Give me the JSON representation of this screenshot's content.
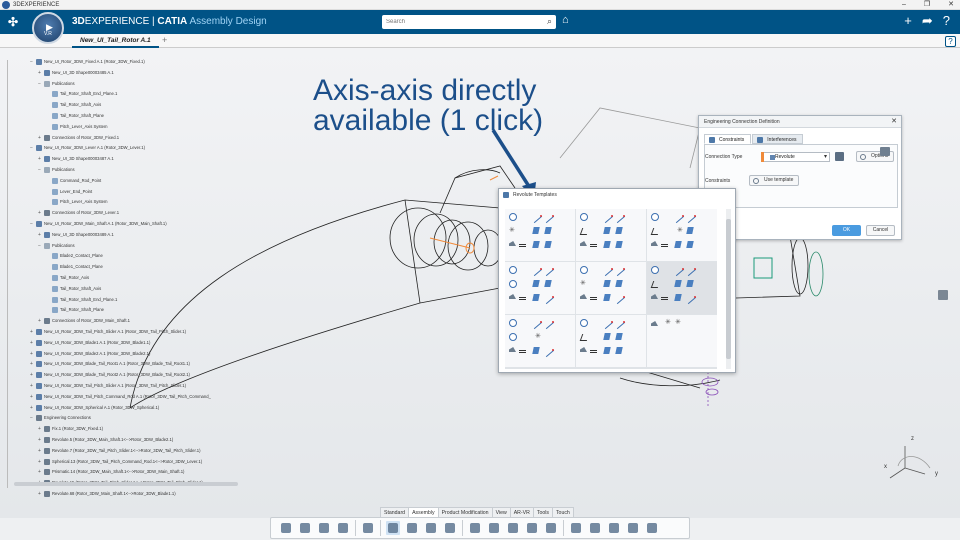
{
  "window": {
    "title": "3DEXPERIENCE",
    "controls": [
      "–",
      "❐",
      "✕"
    ]
  },
  "header": {
    "brand_bold": "3D",
    "brand_rest": "EXPERIENCE",
    "separator": " | ",
    "app_name": "CATIA",
    "app_sub": " Assembly Design",
    "compass_version": "V.R",
    "search_placeholder": "Search"
  },
  "tabs": {
    "active": "New_UI_Tail_Rotor A.1",
    "add": "+"
  },
  "tree": {
    "nodes": [
      {
        "label": "New_UI_Rotor_3DW_Fixed A.1 (Rotor_3DW_Fixed.1)",
        "level": 0,
        "icon": "product-icon",
        "toggle": "−"
      },
      {
        "label": "New_UI_3D Shape00003485 A.1",
        "level": 1,
        "icon": "shape-icon",
        "toggle": "+"
      },
      {
        "label": "Publications",
        "level": 1,
        "icon": "publications-icon",
        "toggle": "−"
      },
      {
        "label": "Tail_Rotor_Shaft_End_Plane.1",
        "level": 2,
        "icon": "plane-icon",
        "toggle": ""
      },
      {
        "label": "Tail_Rotor_Shaft_Axis",
        "level": 2,
        "icon": "plane-icon",
        "toggle": ""
      },
      {
        "label": "Tail_Rotor_Shaft_Plane",
        "level": 2,
        "icon": "plane-icon",
        "toggle": ""
      },
      {
        "label": "Pitch_Lever_Axis System",
        "level": 2,
        "icon": "plane-icon",
        "toggle": ""
      },
      {
        "label": "Connections of Rotor_3DW_Fixed.1",
        "level": 1,
        "icon": "connections-icon",
        "toggle": "+"
      },
      {
        "label": "New_UI_Rotor_3DW_Lever A.1 (Rotor_3DW_Lever.1)",
        "level": 0,
        "icon": "product-icon",
        "toggle": "−"
      },
      {
        "label": "New_UI_3D Shape00003487 A.1",
        "level": 1,
        "icon": "shape-icon",
        "toggle": "+"
      },
      {
        "label": "Publications",
        "level": 1,
        "icon": "publications-icon",
        "toggle": "−"
      },
      {
        "label": "Command_Rod_Point",
        "level": 2,
        "icon": "plane-icon",
        "toggle": ""
      },
      {
        "label": "Lever_End_Point",
        "level": 2,
        "icon": "plane-icon",
        "toggle": ""
      },
      {
        "label": "Pitch_Lever_Axis System",
        "level": 2,
        "icon": "plane-icon",
        "toggle": ""
      },
      {
        "label": "Connections of Rotor_3DW_Lever.1",
        "level": 1,
        "icon": "connections-icon",
        "toggle": "+"
      },
      {
        "label": "New_UI_Rotor_3DW_Main_Shaft A.1 (Rotor_3DW_Main_Shaft.1)",
        "level": 0,
        "icon": "product-icon",
        "toggle": "−"
      },
      {
        "label": "New_UI_3D Shape00003489 A.1",
        "level": 1,
        "icon": "shape-icon",
        "toggle": "+"
      },
      {
        "label": "Publications",
        "level": 1,
        "icon": "publications-icon",
        "toggle": "−"
      },
      {
        "label": "Blade2_Contact_Plane",
        "level": 2,
        "icon": "plane-icon",
        "toggle": ""
      },
      {
        "label": "Blade1_Contact_Plane",
        "level": 2,
        "icon": "plane-icon",
        "toggle": ""
      },
      {
        "label": "Tail_Rotor_Axis",
        "level": 2,
        "icon": "plane-icon",
        "toggle": ""
      },
      {
        "label": "Tail_Rotor_Shaft_Axis",
        "level": 2,
        "icon": "plane-icon",
        "toggle": ""
      },
      {
        "label": "Tail_Rotor_Shaft_End_Plane.1",
        "level": 2,
        "icon": "plane-icon",
        "toggle": ""
      },
      {
        "label": "Tail_Rotor_Shaft_Plane",
        "level": 2,
        "icon": "plane-icon",
        "toggle": ""
      },
      {
        "label": "Connections of Rotor_3DW_Main_Shaft.1",
        "level": 1,
        "icon": "connections-icon",
        "toggle": "+"
      },
      {
        "label": "New_UI_Rotor_3DW_Tail_Pitch_Slider A.1 (Rotor_3DW_Tail_Pitch_Slider.1)",
        "level": 0,
        "icon": "product-icon",
        "toggle": "+"
      },
      {
        "label": "New_UI_Rotor_3DW_Blade1 A.1 (Rotor_3DW_Blade1.1)",
        "level": 0,
        "icon": "product-icon",
        "toggle": "+"
      },
      {
        "label": "New_UI_Rotor_3DW_Blade2 A.1 (Rotor_3DW_Blade2.1)",
        "level": 0,
        "icon": "product-icon",
        "toggle": "+"
      },
      {
        "label": "New_UI_Rotor_3DW_Blade_Tail_Root1 A.1 (Rotor_3DW_Blade_Tail_Root1.1)",
        "level": 0,
        "icon": "product-icon",
        "toggle": "+"
      },
      {
        "label": "New_UI_Rotor_3DW_Blade_Tail_Root2 A.1 (Rotor_3DW_Blade_Tail_Root2.1)",
        "level": 0,
        "icon": "product-icon",
        "toggle": "+"
      },
      {
        "label": "New_UI_Rotor_3DW_Tail_Pitch_Slider A.1 (Rotor_3DW_Tail_Pitch_Slider.1)",
        "level": 0,
        "icon": "product-icon",
        "toggle": "+"
      },
      {
        "label": "New_UI_Rotor_3DW_Tail_Pitch_Command_Rod A.1 (Rotor_3DW_Tail_Pitch_Command_",
        "level": 0,
        "icon": "product-icon",
        "toggle": "+"
      },
      {
        "label": "New_UI_Rotor_3DW_Spherical A.1 (Rotor_3DW_Spherical.1)",
        "level": 0,
        "icon": "product-icon",
        "toggle": "+"
      },
      {
        "label": "Engineering Connections",
        "level": 0,
        "icon": "connections-icon",
        "toggle": "−"
      },
      {
        "label": "Fix.1 (Rotor_3DW_Fixed.1)",
        "level": 1,
        "icon": "connections-icon",
        "toggle": "+"
      },
      {
        "label": "Revolute.5 (Rotor_3DW_Main_Shaft.1<-->Rotor_3DW_Blade2.1)",
        "level": 1,
        "icon": "connections-icon",
        "toggle": "+"
      },
      {
        "label": "Revolute.7 (Rotor_3DW_Tail_Pitch_Slider.1<-->Rotor_3DW_Tail_Pitch_Slider.1)",
        "level": 1,
        "icon": "connections-icon",
        "toggle": "+"
      },
      {
        "label": "Spherical.13 (Rotor_3DW_Tail_Pitch_Command_Rod.1<-->Rotor_3DW_Lever.1)",
        "level": 1,
        "icon": "connections-icon",
        "toggle": "+"
      },
      {
        "label": "Prismatic.14 (Rotor_3DW_Main_Shaft.1<-->Rotor_3DW_Main_Shaft.1)",
        "level": 1,
        "icon": "connections-icon",
        "toggle": "+"
      },
      {
        "label": "Revolute.15 (Rotor_3DW_Tail_Pitch_Slider.1<-->Rotor_3DW_Tail_Pitch_Slider.1)",
        "level": 1,
        "icon": "connections-icon",
        "toggle": "+"
      },
      {
        "label": "Revolute.68 (Rotor_3DW_Main_Shaft.1<-->Rotor_3DW_Blade1.1)",
        "level": 1,
        "icon": "connections-icon",
        "toggle": "+"
      }
    ]
  },
  "annotation": {
    "line1": "Axis-axis directly",
    "line2": "available (1 click)",
    "color": "#1c4f8a"
  },
  "eng_connection_dialog": {
    "title": "Engineering Connection Definition",
    "close": "✕",
    "tabs": [
      "Constraints",
      "Interferences"
    ],
    "connection_type_label": "Connection Type",
    "connection_type_value": "Revolute",
    "options_button": "Options",
    "constraints_label": "Constraints",
    "use_template_button": "Use template",
    "ok_button": "OK",
    "cancel_button": "Cancel",
    "ok_color": "#4a9be0"
  },
  "revolute_templates": {
    "title": "Revolute Templates",
    "cells": 9,
    "highlighted_cell": 5
  },
  "command_tabs": [
    "Standard",
    "Assembly",
    "Product Modification",
    "View",
    "AR-VR",
    "Tools",
    "Touch"
  ],
  "active_command_tab": "Assembly",
  "action_bar_icons": [
    "cut-icon",
    "copy-icon",
    "paste-icon",
    "undo-icon",
    "settings-icon",
    "assembly-icon",
    "move-icon",
    "snap-icon",
    "engineering-connection-icon",
    "fix-icon",
    "explode-icon",
    "clash-icon",
    "section-icon",
    "measure-icon",
    "compass-icon",
    "publish-icon",
    "render-icon",
    "annotate-icon",
    "robot-icon"
  ],
  "colors": {
    "header_bg": "#005386",
    "accent": "#1c4f8a",
    "orange": "#f08a3a"
  }
}
